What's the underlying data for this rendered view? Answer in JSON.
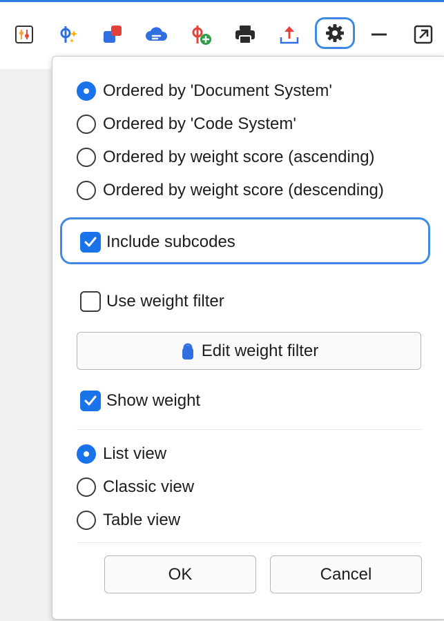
{
  "toolbar": {
    "icons": [
      {
        "name": "code-frame-icon"
      },
      {
        "name": "smart-coding-icon"
      },
      {
        "name": "shapes-icon"
      },
      {
        "name": "cloud-icon"
      },
      {
        "name": "add-code-icon"
      },
      {
        "name": "print-icon"
      },
      {
        "name": "export-icon"
      },
      {
        "name": "settings-gear-icon"
      },
      {
        "name": "minimize-icon"
      },
      {
        "name": "open-external-icon"
      }
    ],
    "accent_color": "#3d8ae6"
  },
  "options": {
    "order_document_system": "Ordered by 'Document System'",
    "order_code_system": "Ordered by 'Code System'",
    "order_weight_asc": "Ordered by weight score (ascending)",
    "order_weight_desc": "Ordered by weight score (descending)",
    "selected_order": "order_document_system",
    "include_subcodes": "Include subcodes",
    "include_subcodes_checked": true,
    "use_weight_filter": "Use weight filter",
    "use_weight_filter_checked": false,
    "edit_weight_filter": "Edit weight filter",
    "show_weight": "Show weight",
    "show_weight_checked": true
  },
  "view": {
    "list_view": "List view",
    "classic_view": "Classic view",
    "table_view": "Table view",
    "selected_view": "list_view"
  },
  "buttons": {
    "ok": "OK",
    "cancel": "Cancel"
  },
  "colors": {
    "primary": "#1a73e8",
    "focus": "#3d8ae6"
  }
}
